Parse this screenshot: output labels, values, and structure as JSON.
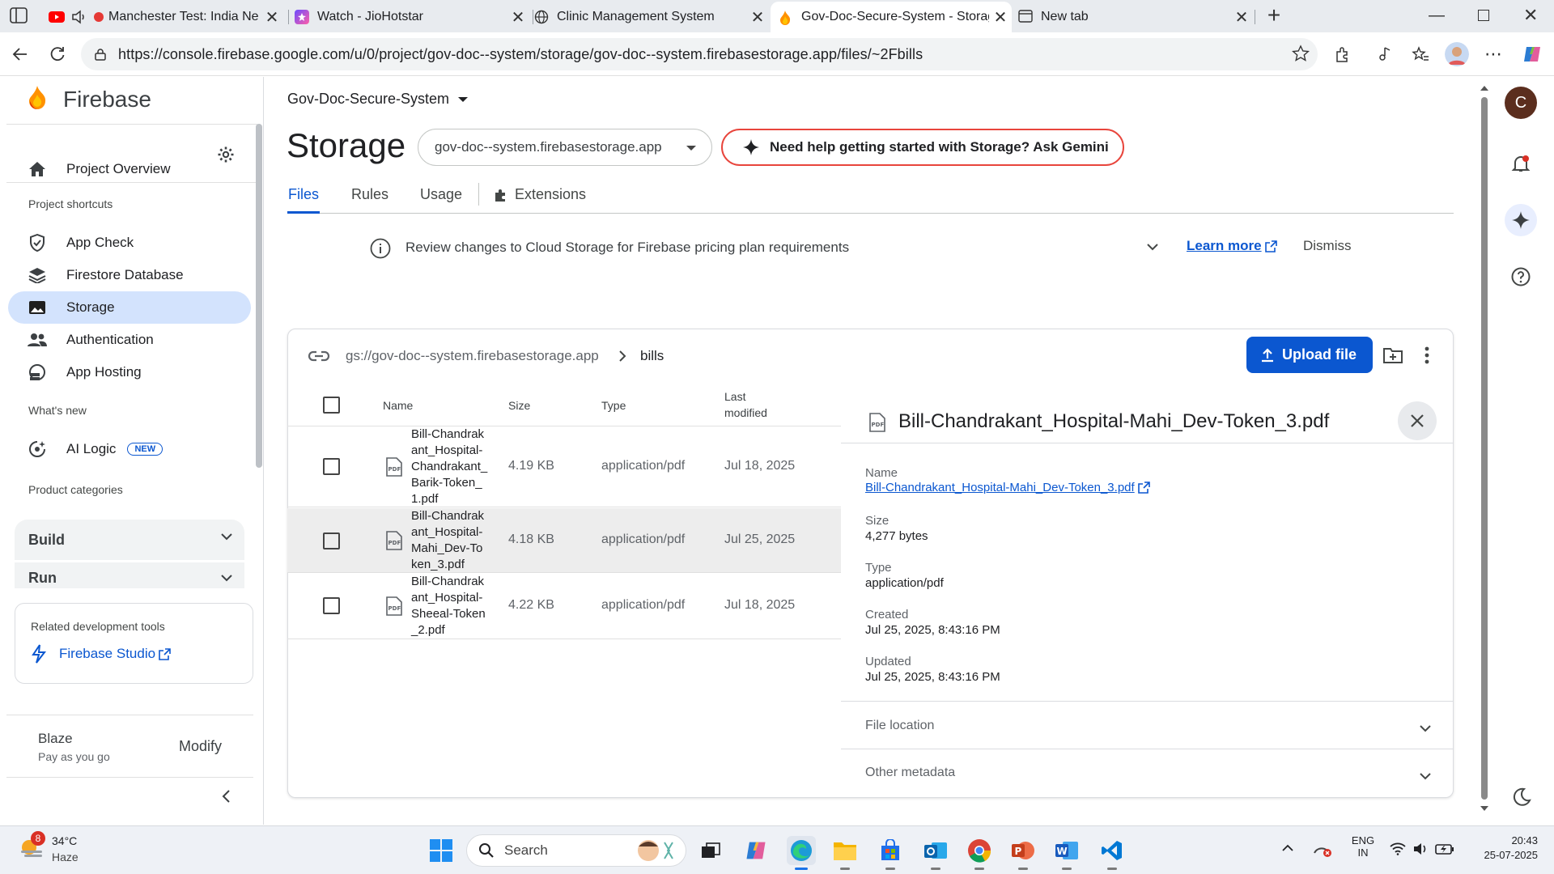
{
  "browser": {
    "tabs": [
      {
        "title": "Manchester Test: India Ne",
        "favicon": "youtube-icon"
      },
      {
        "title": "Watch - JioHotstar",
        "favicon": "jiohotstar-icon"
      },
      {
        "title": "Clinic Management System",
        "favicon": "globe-icon"
      },
      {
        "title": "Gov-Doc-Secure-System - Storag",
        "favicon": "firebase-icon"
      },
      {
        "title": "New tab",
        "favicon": "newtab-icon"
      }
    ],
    "url": "https://console.firebase.google.com/u/0/project/gov-doc--system/storage/gov-doc--system.firebasestorage.app/files/~2Fbills",
    "profile_initial": "C"
  },
  "sidebar": {
    "brand": "Firebase",
    "project_overview": "Project Overview",
    "shortcuts_heading": "Project shortcuts",
    "shortcuts": [
      {
        "label": "App Check",
        "icon": "shield-icon"
      },
      {
        "label": "Firestore Database",
        "icon": "firestore-icon"
      },
      {
        "label": "Storage",
        "icon": "image-icon",
        "selected": true
      },
      {
        "label": "Authentication",
        "icon": "people-icon"
      },
      {
        "label": "App Hosting",
        "icon": "hosting-icon"
      }
    ],
    "whats_new_heading": "What's new",
    "ai_logic": "AI Logic",
    "new_badge": "NEW",
    "product_categories_heading": "Product categories",
    "build": "Build",
    "run": "Run",
    "related_tools_heading": "Related development tools",
    "firebase_studio": "Firebase Studio",
    "plan_name": "Blaze",
    "plan_sub": "Pay as you go",
    "modify": "Modify"
  },
  "header": {
    "project_name": "Gov-Doc-Secure-System",
    "page_title": "Storage",
    "bucket": "gov-doc--system.firebasestorage.app",
    "gemini_prompt": "Need help getting started with Storage? Ask Gemini"
  },
  "tabs": [
    {
      "label": "Files",
      "active": true
    },
    {
      "label": "Rules"
    },
    {
      "label": "Usage"
    },
    {
      "label": "Extensions"
    }
  ],
  "banner": {
    "text": "Review changes to Cloud Storage for Firebase pricing plan requirements",
    "learn_more": "Learn more",
    "dismiss": "Dismiss"
  },
  "browser_panel": {
    "path_root": "gs://gov-doc--system.firebasestorage.app",
    "path_folder": "bills",
    "upload_button": "Upload file",
    "columns": {
      "name": "Name",
      "size": "Size",
      "type": "Type",
      "modified_line1": "Last",
      "modified_line2": "modified"
    },
    "files": [
      {
        "name_lines": [
          "Bill-Chandrak",
          "ant_Hospital-",
          "Chandrakant_",
          "Barik-Token_",
          "1.pdf"
        ],
        "size": "4.19 KB",
        "type": "application/pdf",
        "modified": "Jul 18, 2025"
      },
      {
        "name_lines": [
          "Bill-Chandrak",
          "ant_Hospital-",
          "Mahi_Dev-To",
          "ken_3.pdf"
        ],
        "size": "4.18 KB",
        "type": "application/pdf",
        "modified": "Jul 25, 2025",
        "selected": true
      },
      {
        "name_lines": [
          "Bill-Chandrak",
          "ant_Hospital-",
          "Sheeal-Token",
          "_2.pdf"
        ],
        "size": "4.22 KB",
        "type": "application/pdf",
        "modified": "Jul 18, 2025"
      }
    ]
  },
  "details": {
    "title": "Bill-Chandrakant_Hospital-Mahi_Dev-Token_3.pdf",
    "name_label": "Name",
    "name_value": "Bill-Chandrakant_Hospital-Mahi_Dev-Token_3.pdf",
    "size_label": "Size",
    "size_value": "4,277 bytes",
    "type_label": "Type",
    "type_value": "application/pdf",
    "created_label": "Created",
    "created_value": "Jul 25, 2025, 8:43:16 PM",
    "updated_label": "Updated",
    "updated_value": "Jul 25, 2025, 8:43:16 PM",
    "file_location": "File location",
    "other_metadata": "Other metadata"
  },
  "taskbar": {
    "weather_temp": "34°C",
    "weather_desc": "Haze",
    "weather_badge": "8",
    "search": "Search",
    "lang_line1": "ENG",
    "lang_line2": "IN",
    "time": "20:43",
    "date": "25-07-2025"
  },
  "colors": {
    "accent": "#0b57d0",
    "selected_nav": "#d3e3fd",
    "gemini_border": "#e8453c",
    "firebase_orange": "#ff9100"
  }
}
